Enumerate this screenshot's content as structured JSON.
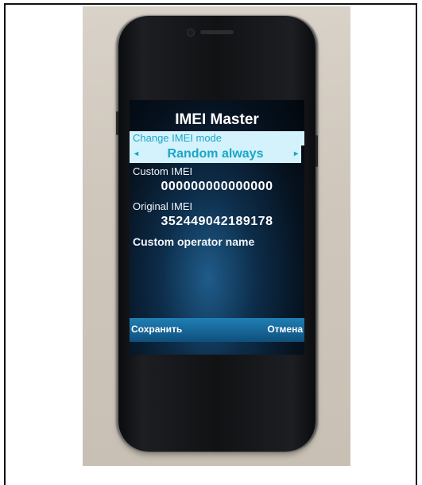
{
  "app": {
    "title": "IMEI Master"
  },
  "mode": {
    "label": "Change IMEI mode",
    "value": "Random always",
    "left_arrow": "◂",
    "right_arrow": "▸"
  },
  "custom_imei": {
    "label": "Custom IMEI",
    "value": "000000000000000"
  },
  "original_imei": {
    "label": "Original IMEI",
    "value": "352449042189178"
  },
  "operator": {
    "label": "Custom operator name"
  },
  "softkeys": {
    "left": "Сохранить",
    "right": "Отмена"
  },
  "colors": {
    "highlight_bg": "#d4f2fb",
    "highlight_text": "#1aa6c9",
    "softbar": "#1f7fb5"
  }
}
